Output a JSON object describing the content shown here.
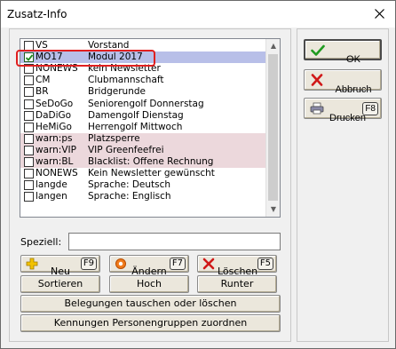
{
  "window": {
    "title": "Zusatz-Info",
    "close_glyph": "✕"
  },
  "list": {
    "rows": [
      {
        "code": "VS",
        "desc": "Vorstand",
        "checked": false,
        "style": "normal"
      },
      {
        "code": "MO17",
        "desc": "Modul 2017",
        "checked": true,
        "style": "selected"
      },
      {
        "code": "NONEWS",
        "desc": "kein Newsletter",
        "checked": false,
        "style": "normal"
      },
      {
        "code": "CM",
        "desc": "Clubmannschaft",
        "checked": false,
        "style": "normal"
      },
      {
        "code": "BR",
        "desc": "Bridgerunde",
        "checked": false,
        "style": "normal"
      },
      {
        "code": "SeDoGo",
        "desc": "Seniorengolf Donnerstag",
        "checked": false,
        "style": "normal"
      },
      {
        "code": "DaDiGo",
        "desc": "Damengolf Dienstag",
        "checked": false,
        "style": "normal"
      },
      {
        "code": "HeMiGo",
        "desc": "Herrengolf Mittwoch",
        "checked": false,
        "style": "normal"
      },
      {
        "code": "warn:ps",
        "desc": "Platzsperre",
        "checked": false,
        "style": "pink"
      },
      {
        "code": "warn:VIP",
        "desc": "VIP  Greenfeefrei",
        "checked": false,
        "style": "pink"
      },
      {
        "code": "warn:BL",
        "desc": "Blacklist: Offene Rechnung",
        "checked": false,
        "style": "pink"
      },
      {
        "code": "NONEWS",
        "desc": "Kein Newsletter gewünscht",
        "checked": false,
        "style": "normal"
      },
      {
        "code": "langde",
        "desc": "Sprache: Deutsch",
        "checked": false,
        "style": "normal"
      },
      {
        "code": "langen",
        "desc": "Sprache: Englisch",
        "checked": false,
        "style": "normal"
      }
    ],
    "colors": {
      "selected": "#b8bfe8",
      "pink": "#ecd8dc",
      "highlight_border": "#e02020"
    }
  },
  "speziell": {
    "label": "Speziell:",
    "value": ""
  },
  "buttons": {
    "neu": {
      "label": "Neu",
      "key": "F9",
      "icon": "plus-icon"
    },
    "aendern": {
      "label": "Ändern",
      "key": "F7",
      "icon": "edit-circle-icon"
    },
    "loeschen": {
      "label": "Löschen",
      "key": "F5",
      "icon": "delete-x-icon"
    },
    "sortieren": {
      "label": "Sortieren"
    },
    "hoch": {
      "label": "Hoch"
    },
    "runter": {
      "label": "Runter"
    },
    "tauschen": {
      "label": "Belegungen tauschen oder löschen"
    },
    "zuordnen": {
      "label": "Kennungen Personengruppen zuordnen"
    }
  },
  "side": {
    "ok": {
      "label": "OK",
      "icon": "checkmark-icon"
    },
    "abbruch": {
      "label": "Abbruch",
      "icon": "cancel-x-icon"
    },
    "drucken": {
      "label": "Drucken",
      "key": "F8",
      "icon": "printer-icon"
    }
  }
}
